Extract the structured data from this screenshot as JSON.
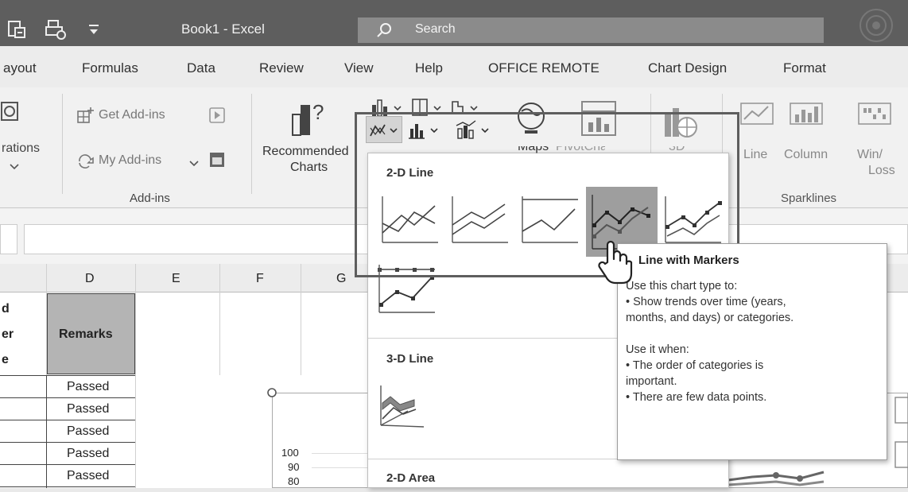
{
  "title_bar": {
    "title": "Book1  -  Excel",
    "search_placeholder": "Search"
  },
  "tabs": [
    "ayout",
    "Formulas",
    "Data",
    "Review",
    "View",
    "Help",
    "OFFICE REMOTE",
    "Chart Design",
    "Format"
  ],
  "ribbon": {
    "registrations_label": "rations",
    "get_addins": "Get Add-ins",
    "my_addins": "My Add-ins",
    "addins_group": "Add-ins",
    "recommended_line1": "Recommended",
    "recommended_line2": "Charts",
    "maps": "Maps",
    "pivotchart": "PivotChart",
    "threed": "3D",
    "sparkline_line": "Line",
    "sparkline_column": "Column",
    "sparkline_winloss_1": "Win/",
    "sparkline_winloss_2": "Loss",
    "sparklines_group": "Sparklines"
  },
  "sheet": {
    "col_d": "D",
    "col_e": "E",
    "col_f": "F",
    "col_g": "G",
    "partial_header": [
      "d",
      "er",
      "e"
    ],
    "remarks_header": "Remarks",
    "remarks": [
      "Passed",
      "Passed",
      "Passed",
      "Passed",
      "Passed"
    ],
    "axis_ticks": [
      "100",
      "90",
      "80"
    ]
  },
  "gallery": {
    "section_2d_line": "2-D Line",
    "section_3d_line": "3-D Line",
    "section_2d_area": "2-D Area"
  },
  "tooltip": {
    "title": "Line with Markers",
    "lines": [
      "Use this chart type to:",
      "• Show trends over time (years,",
      "months, and days) or categories.",
      "",
      "Use it when:",
      "• The order of categories is",
      "important.",
      "• There are few data points."
    ]
  },
  "colors": {
    "titlebar": "#5e5e5e",
    "remarks_header_bg": "#b4b4b4",
    "selected_thumb": "#9e9e9e",
    "highlight_border": "#5e5e5e"
  }
}
